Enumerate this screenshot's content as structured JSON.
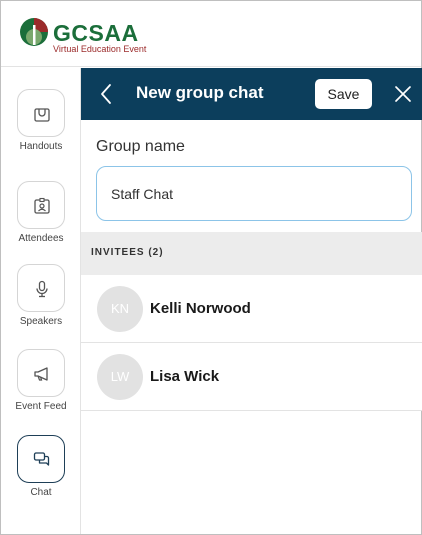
{
  "brand": {
    "title": "GCSAA",
    "subtitle": "Virtual Education Event",
    "colors": {
      "green": "#1b6e3a",
      "red": "#9b2a2a",
      "navy": "#0c3e5c"
    }
  },
  "sidebar": {
    "items": [
      {
        "label": "Handouts",
        "icon": "bag-icon"
      },
      {
        "label": "Attendees",
        "icon": "badge-icon"
      },
      {
        "label": "Speakers",
        "icon": "microphone-icon"
      },
      {
        "label": "Event Feed",
        "icon": "megaphone-icon"
      },
      {
        "label": "Chat",
        "icon": "chat-icon",
        "active": true
      }
    ]
  },
  "header": {
    "title": "New group chat",
    "save_label": "Save",
    "back_icon": "chevron-left-icon",
    "close_icon": "close-icon"
  },
  "form": {
    "group_label": "Group name",
    "group_value": "Staff Chat"
  },
  "invitees": {
    "heading": "INVITEES (2)",
    "people": [
      {
        "initials": "KN",
        "name": "Kelli Norwood"
      },
      {
        "initials": "LW",
        "name": "Lisa Wick"
      }
    ]
  }
}
